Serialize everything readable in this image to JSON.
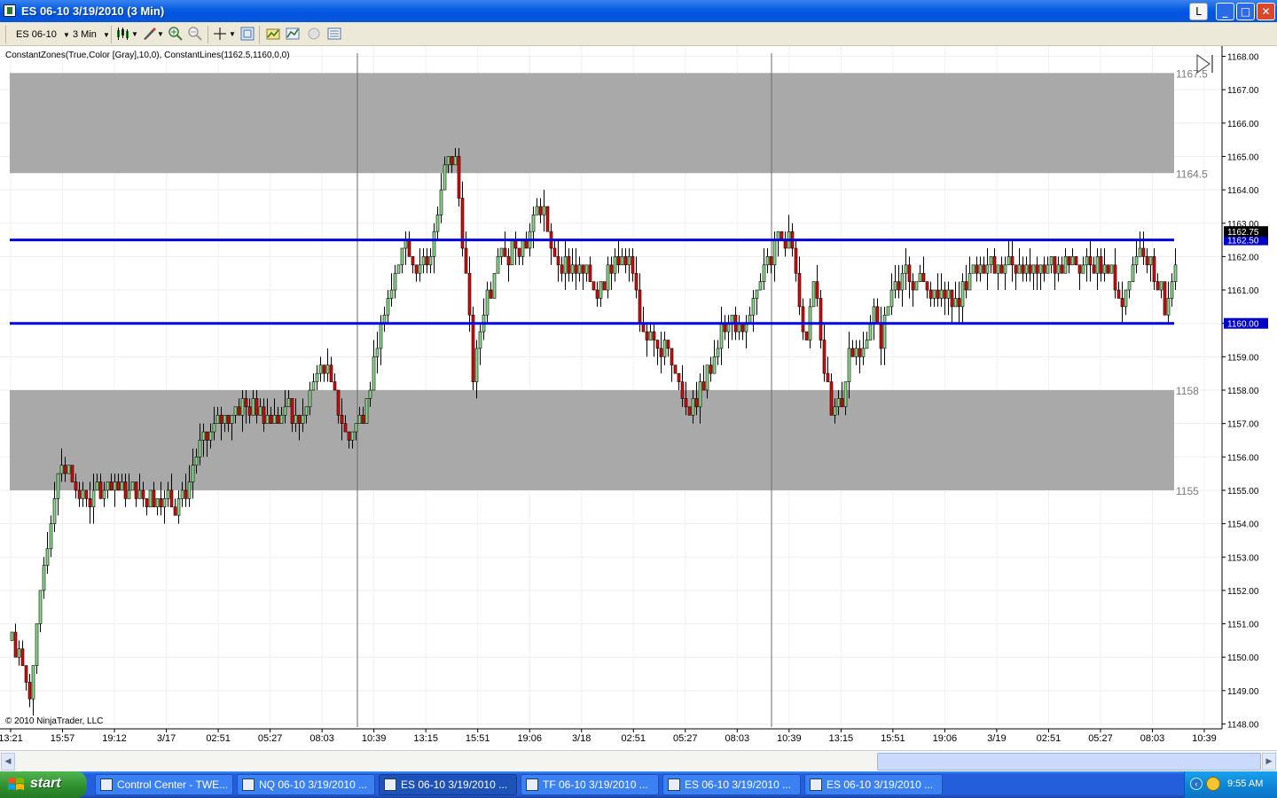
{
  "window": {
    "title": "ES 06-10  3/19/2010  (3 Min)",
    "buttons": {
      "layout": "L",
      "minimize": "_",
      "maximize": "□",
      "close": "✕"
    }
  },
  "toolbar": {
    "instrument": "ES 06-10",
    "interval": "3 Min",
    "icons": [
      "bar-type-icon",
      "drawing-tool-icon",
      "zoom-in-icon",
      "zoom-out-icon",
      "crosshair-icon",
      "properties-icon",
      "indicators-icon",
      "strategies-icon",
      "global-link-icon",
      "data-box-icon"
    ]
  },
  "chart": {
    "indicator_label": "ConstantZones(True,Color [Gray],10,0), ConstantLines(1162.5,1160,0,0)",
    "copyright": "© 2010 NinjaTrader, LLC"
  },
  "chart_data": {
    "type": "candlestick",
    "ylim": [
      1148,
      1168
    ],
    "y_ticks": [
      "1148.00",
      "1149.00",
      "1150.00",
      "1151.00",
      "1152.00",
      "1153.00",
      "1154.00",
      "1155.00",
      "1156.00",
      "1157.00",
      "1158.00",
      "1159.00",
      "1160.00",
      "1161.00",
      "1162.00",
      "1163.00",
      "1164.00",
      "1165.00",
      "1166.00",
      "1167.00",
      "1168.00"
    ],
    "x_ticks": [
      "13:21",
      "15:57",
      "19:12",
      "3/17",
      "02:51",
      "05:27",
      "08:03",
      "10:39",
      "13:15",
      "15:51",
      "19:06",
      "3/18",
      "02:51",
      "05:27",
      "08:03",
      "10:39",
      "13:15",
      "15:51",
      "19:06",
      "3/19",
      "02:51",
      "05:27",
      "08:03",
      "10:39"
    ],
    "zones": [
      {
        "from": 1164.5,
        "to": 1167.5,
        "labels": [
          "1167.5",
          "1164.5"
        ],
        "color": "#a9a9a9"
      },
      {
        "from": 1155,
        "to": 1158,
        "labels": [
          "1158",
          "1155"
        ],
        "color": "#a9a9a9"
      }
    ],
    "lines": [
      {
        "value": 1162.5,
        "label": "1162.50",
        "color": "#0000e0"
      },
      {
        "value": 1160,
        "label": "1160.00",
        "color": "#0000e0"
      }
    ],
    "last_price": {
      "value": 1162.75,
      "label": "1162.75"
    },
    "session_dividers": [
      "08:03-10:39 3/17",
      "08:03-10:39 3/18"
    ],
    "up_color": "#90d890",
    "down_color": "#d01010",
    "path_keypoints": [
      [
        0,
        1150.4
      ],
      [
        20,
        1149.0
      ],
      [
        40,
        1153.5
      ],
      [
        55,
        1156.0
      ],
      [
        75,
        1154.8
      ],
      [
        130,
        1155.0
      ],
      [
        190,
        1154.6
      ],
      [
        215,
        1156.5
      ],
      [
        260,
        1157.6
      ],
      [
        290,
        1157.2
      ],
      [
        330,
        1157.3
      ],
      [
        350,
        1158.8
      ],
      [
        365,
        1157.8
      ],
      [
        378,
        1156.4
      ],
      [
        400,
        1157.6
      ],
      [
        420,
        1160.5
      ],
      [
        440,
        1162.3
      ],
      [
        470,
        1161.5
      ],
      [
        487,
        1164.8
      ],
      [
        500,
        1164.9
      ],
      [
        510,
        1162.0
      ],
      [
        520,
        1158.5
      ],
      [
        535,
        1161.0
      ],
      [
        555,
        1162.2
      ],
      [
        580,
        1162.5
      ],
      [
        595,
        1163.5
      ],
      [
        610,
        1162.0
      ],
      [
        660,
        1161.2
      ],
      [
        690,
        1162.2
      ],
      [
        700,
        1161.5
      ],
      [
        710,
        1159.8
      ],
      [
        740,
        1159.2
      ],
      [
        760,
        1157.5
      ],
      [
        790,
        1158.8
      ],
      [
        800,
        1159.8
      ],
      [
        830,
        1160.0
      ],
      [
        845,
        1161.3
      ],
      [
        860,
        1162.5
      ],
      [
        880,
        1162.4
      ],
      [
        895,
        1159.3
      ],
      [
        905,
        1161.8
      ],
      [
        915,
        1158.8
      ],
      [
        925,
        1157.0
      ],
      [
        940,
        1158.2
      ],
      [
        945,
        1159.5
      ],
      [
        960,
        1159.2
      ],
      [
        970,
        1160.5
      ],
      [
        980,
        1159.5
      ],
      [
        995,
        1161.5
      ],
      [
        1060,
        1160.8
      ],
      [
        1080,
        1161.2
      ],
      [
        1100,
        1161.8
      ],
      [
        1140,
        1161.6
      ],
      [
        1200,
        1161.8
      ],
      [
        1240,
        1161.6
      ],
      [
        1250,
        1160.5
      ],
      [
        1262,
        1161.3
      ],
      [
        1275,
        1162.2
      ],
      [
        1290,
        1161.2
      ],
      [
        1300,
        1160.5
      ],
      [
        1312,
        1161.6
      ],
      [
        1325,
        1162.75
      ]
    ]
  },
  "scrollbar": {
    "left_arrow": "◀",
    "right_arrow": "▶"
  },
  "taskbar": {
    "start_label": "start",
    "tasks": [
      {
        "label": "Control Center - TWE...",
        "active": false
      },
      {
        "label": "NQ 06-10  3/19/2010 ...",
        "active": false
      },
      {
        "label": "ES 06-10  3/19/2010 ...",
        "active": true
      },
      {
        "label": "TF 06-10  3/19/2010 ...",
        "active": false
      },
      {
        "label": "ES 06-10  3/19/2010 ...",
        "active": false
      },
      {
        "label": "ES 06-10  3/19/2010 ...",
        "active": false
      }
    ],
    "clock": "9:55 AM"
  }
}
